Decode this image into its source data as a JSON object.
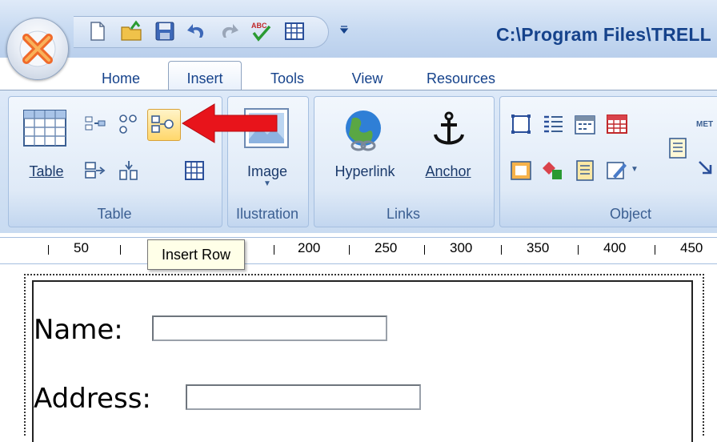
{
  "window": {
    "title": "C:\\Program Files\\TRELL"
  },
  "quick_access": {
    "icons": [
      "new-document-icon",
      "open-folder-icon",
      "save-icon",
      "undo-icon",
      "redo-icon",
      "spellcheck-icon",
      "table-icon"
    ],
    "more_label": "→",
    "customize_glyph": "═"
  },
  "tabs": [
    "Home",
    "Insert",
    "Tools",
    "View",
    "Resources"
  ],
  "active_tab": "Insert",
  "ribbon": {
    "table_group": {
      "label": "Table",
      "table_button_label": "Table",
      "highlighted_button": "insert-row",
      "annotation": "red arrow pointing at Insert Row button"
    },
    "illustration_group": {
      "label": "Ilustration",
      "image_label": "Image"
    },
    "links_group": {
      "label": "Links",
      "hyperlink_label": "Hyperlink",
      "anchor_label": "Anchor"
    },
    "object_group": {
      "label": "Object",
      "meta_label": "MET"
    }
  },
  "tooltip": {
    "text": "Insert Row"
  },
  "ruler": {
    "labels": [
      "50",
      "200",
      "250",
      "300",
      "350",
      "400",
      "450"
    ]
  },
  "form": {
    "name_label": "Name:",
    "name_value": "",
    "address_label": "Address:",
    "address_value": ""
  },
  "colors": {
    "accent_text": "#15428b",
    "ribbon_bg": "#c9dbf1",
    "arrow": "#e8141b",
    "highlight": "#ffd76b"
  }
}
